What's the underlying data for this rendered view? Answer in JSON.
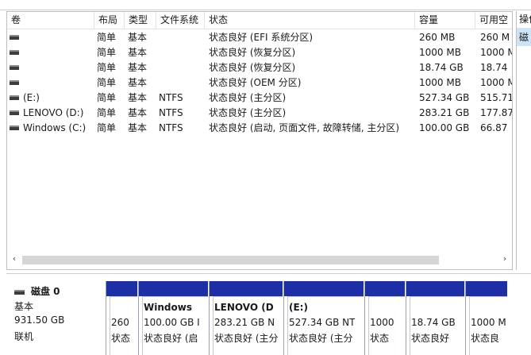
{
  "columns": [
    "卷",
    "布局",
    "类型",
    "文件系统",
    "状态",
    "容量",
    "可用空"
  ],
  "rows": [
    {
      "volume": "",
      "layout": "简单",
      "type": "基本",
      "fs": "",
      "status": "状态良好 (EFI 系统分区)",
      "capacity": "260 MB",
      "free": "260 M"
    },
    {
      "volume": "",
      "layout": "简单",
      "type": "基本",
      "fs": "",
      "status": "状态良好 (恢复分区)",
      "capacity": "1000 MB",
      "free": "1000 M"
    },
    {
      "volume": "",
      "layout": "简单",
      "type": "基本",
      "fs": "",
      "status": "状态良好 (恢复分区)",
      "capacity": "18.74 GB",
      "free": "18.74"
    },
    {
      "volume": "",
      "layout": "简单",
      "type": "基本",
      "fs": "",
      "status": "状态良好 (OEM 分区)",
      "capacity": "1000 MB",
      "free": "1000 M"
    },
    {
      "volume": "(E:)",
      "layout": "简单",
      "type": "基本",
      "fs": "NTFS",
      "status": "状态良好 (主分区)",
      "capacity": "527.34 GB",
      "free": "515.71"
    },
    {
      "volume": "LENOVO (D:)",
      "layout": "简单",
      "type": "基本",
      "fs": "NTFS",
      "status": "状态良好 (主分区)",
      "capacity": "283.21 GB",
      "free": "177.87"
    },
    {
      "volume": "Windows (C:)",
      "layout": "简单",
      "type": "基本",
      "fs": "NTFS",
      "status": "状态良好 (启动, 页面文件, 故障转储, 主分区)",
      "capacity": "100.00 GB",
      "free": "66.87"
    }
  ],
  "scrollbar": {
    "left_arrow": "‹",
    "right_arrow": "›"
  },
  "actions": {
    "header": "操作",
    "item": "磁"
  },
  "disk": {
    "name": "磁盘 0",
    "type": "基本",
    "size": "931.50 GB",
    "status": "联机"
  },
  "partitions": [
    {
      "name": "",
      "size": "260",
      "status": "状态"
    },
    {
      "name": "Windows",
      "size": "100.00 GB I",
      "status": "状态良好 (启"
    },
    {
      "name": "LENOVO (D",
      "size": "283.21 GB N",
      "status": "状态良好 (主分"
    },
    {
      "name": "(E:)",
      "size": "527.34 GB NT",
      "status": "状态良好 (主分"
    },
    {
      "name": "",
      "size": "1000",
      "status": "状态"
    },
    {
      "name": "",
      "size": "18.74 GB",
      "status": "状态良好"
    },
    {
      "name": "",
      "size": "1000 M",
      "status": "状态良"
    }
  ],
  "colors": {
    "partition_bar": "#1c2fa6",
    "selection": "#cce4f7"
  }
}
